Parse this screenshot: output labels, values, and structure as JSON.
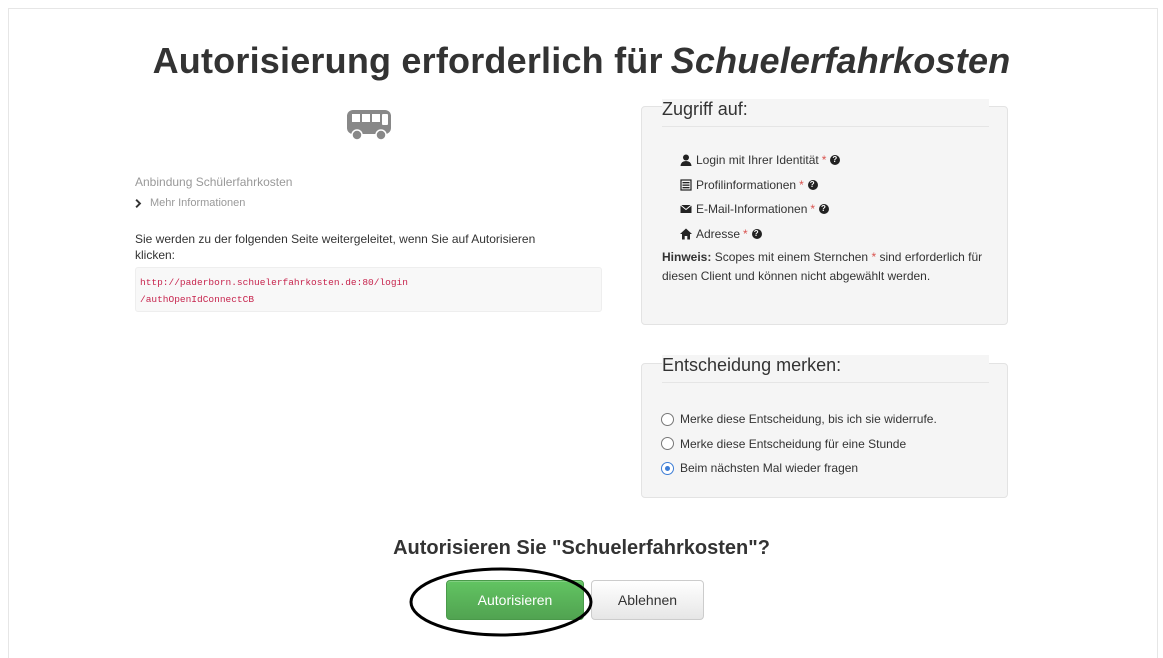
{
  "header": {
    "title_prefix": "Autorisierung erforderlich für",
    "app_name": "Schuelerfahrkosten"
  },
  "client": {
    "icon": "bus-icon",
    "name": "Anbindung Schülerfahrkosten",
    "more_info": "Mehr Informationen",
    "redirect_text": "Sie werden zu der folgenden Seite weitergeleitet, wenn Sie auf Autorisieren klicken:",
    "redirect_uri_line1": "http://paderborn.schuelerfahrkosten.de:80/login",
    "redirect_uri_line2": "/authOpenIdConnectCB"
  },
  "scopes": {
    "legend": "Zugriff auf:",
    "items": [
      {
        "label": "Login mit Ihrer Identität",
        "icon": "user-icon",
        "required": "*"
      },
      {
        "label": "Profilinformationen",
        "icon": "list-icon",
        "required": "*"
      },
      {
        "label": "E-Mail-Informationen",
        "icon": "envelope-icon",
        "required": "*"
      },
      {
        "label": "Adresse",
        "icon": "home-icon",
        "required": "*"
      }
    ],
    "hint_label": "Hinweis:",
    "hint_before_star": "Scopes mit einem Sternchen",
    "hint_star": "*",
    "hint_after_star": "sind erforderlich für diesen Client und können nicht abgewählt werden."
  },
  "remember": {
    "legend": "Entscheidung merken:",
    "options": [
      {
        "label": "Merke diese Entscheidung, bis ich sie widerrufe.",
        "checked": false
      },
      {
        "label": "Merke diese Entscheidung für eine Stunde",
        "checked": false
      },
      {
        "label": "Beim nächsten Mal wieder fragen",
        "checked": true
      }
    ]
  },
  "footer": {
    "question": "Autorisieren Sie \"Schuelerfahrkosten\"?",
    "authorize_label": "Autorisieren",
    "deny_label": "Ablehnen"
  },
  "colors": {
    "primary_green": "#5bb75b",
    "required_red": "#d9534f",
    "radio_blue": "#3c7dd6"
  }
}
